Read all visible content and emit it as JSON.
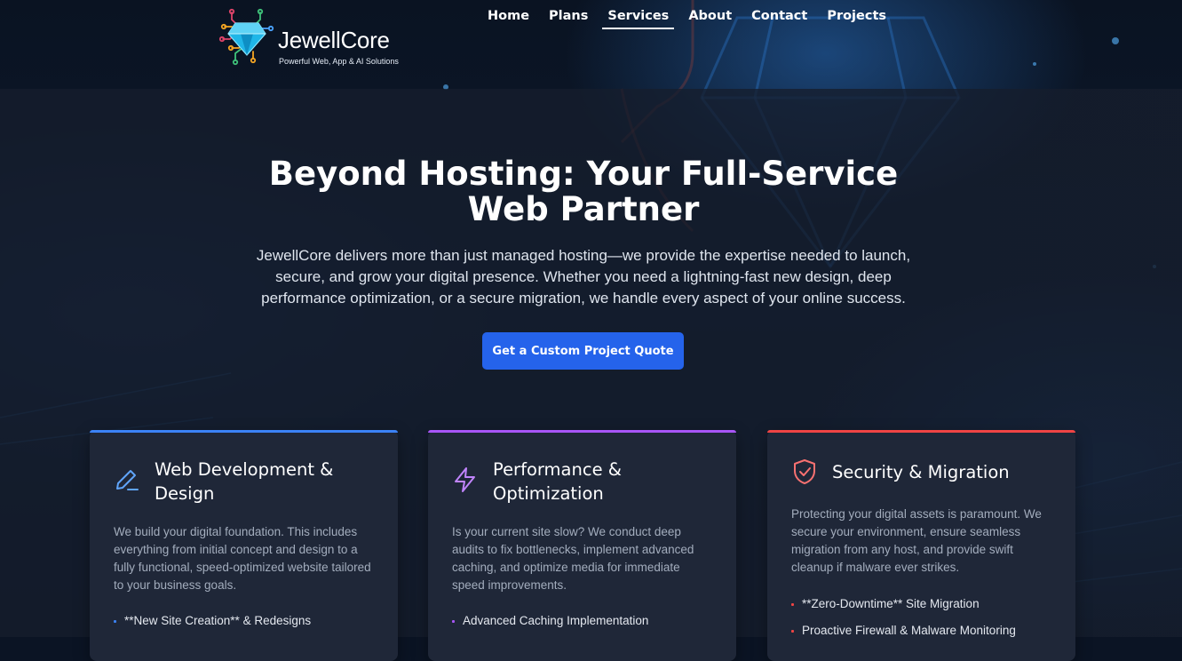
{
  "brand": {
    "name": "JewellCore",
    "tagline": "Powerful Web, App & AI Solutions"
  },
  "nav": {
    "items": [
      "Home",
      "Plans",
      "Services",
      "About",
      "Contact",
      "Projects"
    ],
    "active": "Services"
  },
  "hero": {
    "title_line1": "Beyond Hosting: Your Full-Service",
    "title_line2": "Web Partner",
    "description": "JewellCore delivers more than just managed hosting—we provide the expertise needed to launch, secure, and grow your digital presence. Whether you need a lightning-fast new design, deep performance optimization, or a secure migration, we handle every aspect of your online success.",
    "cta_label": "Get a Custom Project Quote"
  },
  "services": [
    {
      "icon": "pencil-icon",
      "accent": "#3b82f6",
      "title_line1": "Web Development &",
      "title_line2": "Design",
      "description": "We build your digital foundation. This includes everything from initial concept and design to a fully functional, speed-optimized website tailored to your business goals.",
      "features": [
        "**New Site Creation** & Redesigns"
      ]
    },
    {
      "icon": "lightning-icon",
      "accent": "#a855f7",
      "title_line1": "Performance &",
      "title_line2": "Optimization",
      "description": "Is your current site slow? We conduct deep audits to fix bottlenecks, implement advanced caching, and optimize media for immediate speed improvements.",
      "features": [
        "Advanced Caching Implementation"
      ]
    },
    {
      "icon": "shield-check-icon",
      "accent": "#ef4444",
      "title_line1": "Security & Migration",
      "title_line2": "",
      "description": "Protecting your digital assets is paramount. We secure your environment, ensure seamless migration from any host, and provide swift cleanup if malware ever strikes.",
      "features": [
        "**Zero-Downtime** Site Migration",
        "Proactive Firewall & Malware Monitoring"
      ]
    }
  ],
  "colors": {
    "background": "#0b1424",
    "card": "#1f2738",
    "primary_button": "#2563eb"
  }
}
